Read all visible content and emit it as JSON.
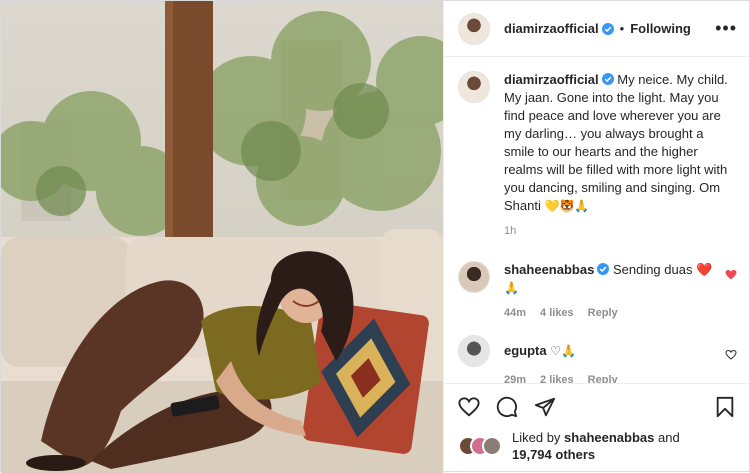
{
  "post": {
    "author": "diamirzaofficial",
    "follow_status": "Following",
    "separator": "•",
    "more": "•••",
    "caption": "My neice. My child. My jaan. Gone into the light. May you find peace and love wherever you are my darling… you always brought a smile to our hearts and the higher realms will be filled with more light with you dancing, smiling and singing. Om Shanti",
    "caption_emojis": "💛🐯🙏",
    "time": "1h"
  },
  "comments": [
    {
      "user": "shaheenabbas",
      "text": "Sending duas ❤️",
      "emoji_line": "🙏",
      "age": "44m",
      "likes": "4 likes",
      "reply": "Reply",
      "liked": true
    },
    {
      "user": "egupta",
      "text": "♡🙏",
      "age": "29m",
      "likes": "2 likes",
      "reply": "Reply",
      "liked": false
    }
  ],
  "footer": {
    "liked_by_prefix": "Liked by",
    "liked_by_user": "shaheenabbas",
    "and": "and",
    "others": "19,794 others"
  },
  "icons": {
    "like": "heart-icon",
    "comment": "comment-icon",
    "share": "share-icon",
    "save": "bookmark-icon",
    "verified": "verified-badge-icon"
  },
  "colors": {
    "verified": "#3897f0",
    "liked_heart": "#ed4956"
  }
}
